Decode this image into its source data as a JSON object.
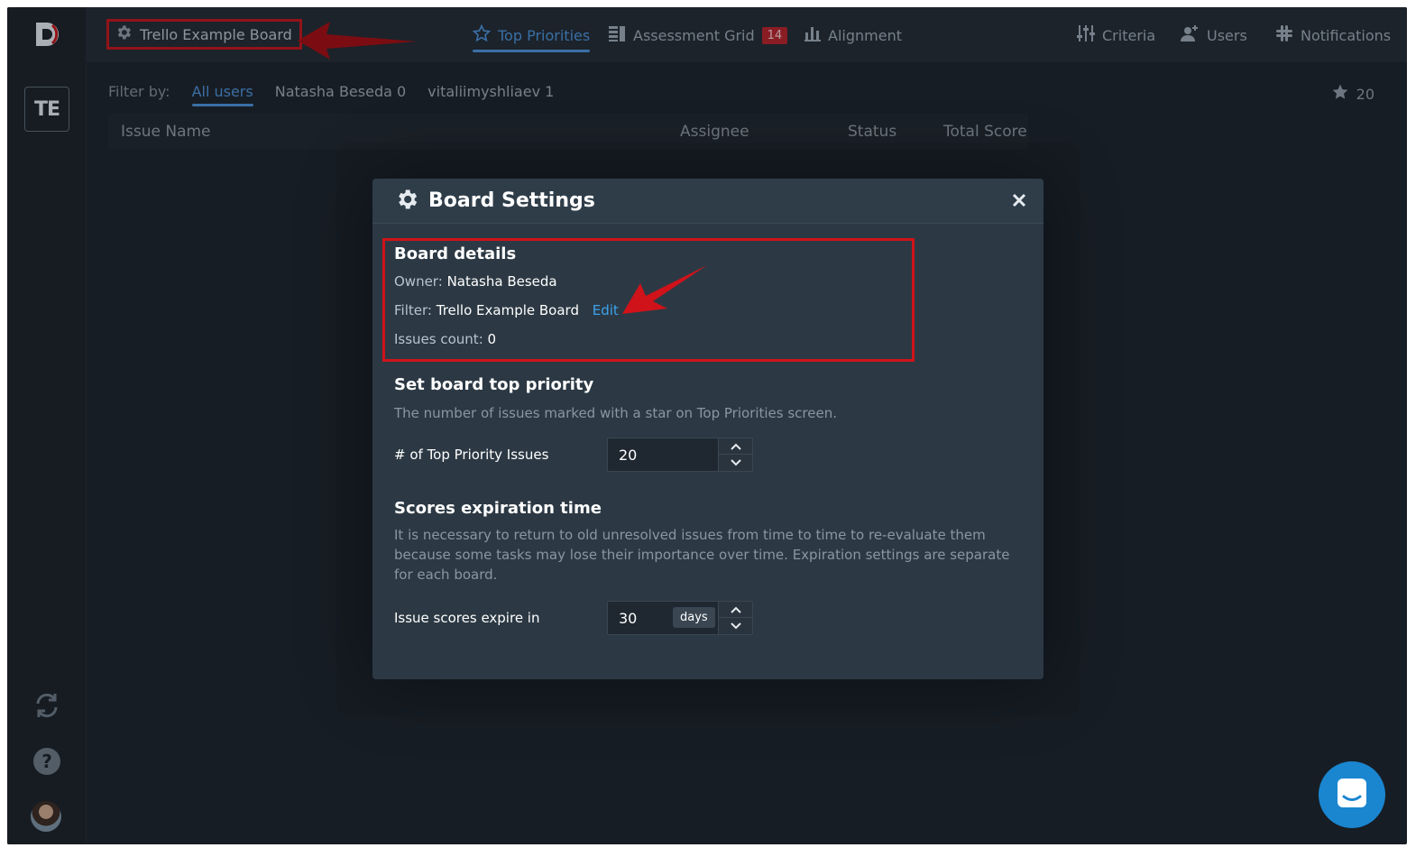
{
  "sidebar": {
    "logo_letter": "D",
    "board_abbr": "TE"
  },
  "topbar": {
    "board_title": "Trello Example Board",
    "nav": [
      {
        "label": "Top Priorities",
        "icon": "star-icon",
        "active": true
      },
      {
        "label": "Assessment Grid",
        "icon": "grid-icon",
        "badge": "14"
      },
      {
        "label": "Alignment",
        "icon": "bar-chart-icon"
      },
      {
        "label": "Criteria",
        "icon": "sliders-icon"
      },
      {
        "label": "Users",
        "icon": "add-user-icon"
      },
      {
        "label": "Notifications",
        "icon": "slack-icon"
      }
    ]
  },
  "filter": {
    "label": "Filter by:",
    "options": [
      "All users",
      "Natasha Beseda 0",
      "vitaliimyshliaev 1"
    ],
    "star_count": "20"
  },
  "table": {
    "columns": [
      "Issue Name",
      "Assignee",
      "Status",
      "Total Score"
    ]
  },
  "modal": {
    "title": "Board Settings",
    "board_details": {
      "heading": "Board details",
      "owner_label": "Owner:",
      "owner_value": "Natasha Beseda",
      "filter_label": "Filter:",
      "filter_value": "Trello Example Board",
      "edit_link": "Edit",
      "issues_label": "Issues count:",
      "issues_value": "0"
    },
    "top_priority": {
      "heading": "Set board top priority",
      "description": "The number of issues marked with a star on Top Priorities screen.",
      "field_label": "# of Top Priority Issues",
      "value": "20"
    },
    "expiration": {
      "heading": "Scores expiration time",
      "description": "It is necessary to return to old unresolved issues from time to time to re-evaluate them because some tasks may lose their importance over time. Expiration settings are separate for each board.",
      "field_label": "Issue scores expire in",
      "value": "30",
      "unit": "days"
    }
  },
  "colors": {
    "accent": "#4a8fd6",
    "annotation_red": "#c0141a",
    "link": "#3ea2ec"
  }
}
